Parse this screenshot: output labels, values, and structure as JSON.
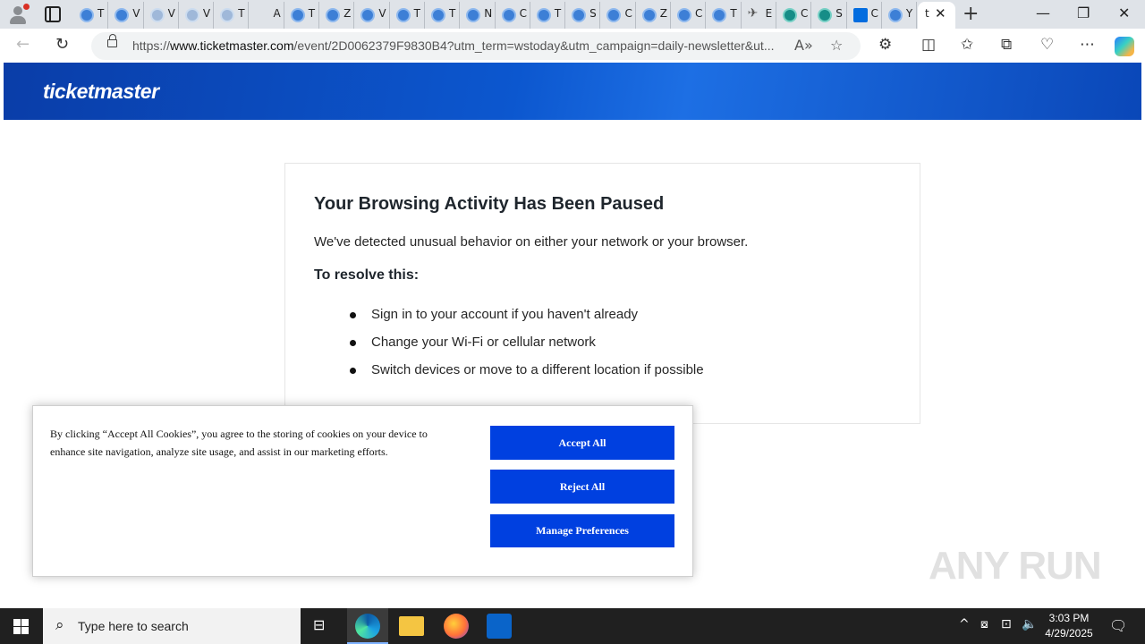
{
  "browser": {
    "background_tab_chars": [
      "T",
      "V",
      "V",
      "V",
      "T",
      "A",
      "T",
      "Z",
      "V",
      "T",
      "T",
      "N",
      "C",
      "T",
      "S",
      "C",
      "Z",
      "C",
      "T",
      "E",
      "C",
      "S",
      "C",
      "Y"
    ],
    "active_tab_char": "t",
    "active_tab_close": "✕",
    "new_tab": "+",
    "url_prefix": "https://",
    "url_domain": "www.ticketmaster.com",
    "url_rest": "/event/2D0062379F9830B4?utm_term=wstoday&utm_campaign=daily-newsletter&ut..."
  },
  "page": {
    "brand": "ticketmaster",
    "title": "Your Browsing Activity Has Been Paused",
    "lead": "We've detected unusual behavior on either your network or your browser.",
    "resolve_heading": "To resolve this:",
    "steps": [
      "Sign in to your account if you haven't already",
      "Change your Wi-Fi or cellular network",
      "Switch devices or move to a different location if possible"
    ],
    "watermark": "ANY RUN"
  },
  "cookie_banner": {
    "text": "By clicking “Accept All Cookies”, you agree to the storing of cookies on your device to enhance site navigation, analyze site usage, and assist in our marketing efforts.",
    "accept_label": "Accept All",
    "reject_label": "Reject All",
    "manage_label": "Manage Preferences",
    "button_color": "#0040e0"
  },
  "taskbar": {
    "search_placeholder": "Type here to search",
    "time": "3:03 PM",
    "date": "4/29/2025"
  },
  "colors": {
    "brand_blue": "#026cdf",
    "header_blue": "#0c57cf"
  }
}
